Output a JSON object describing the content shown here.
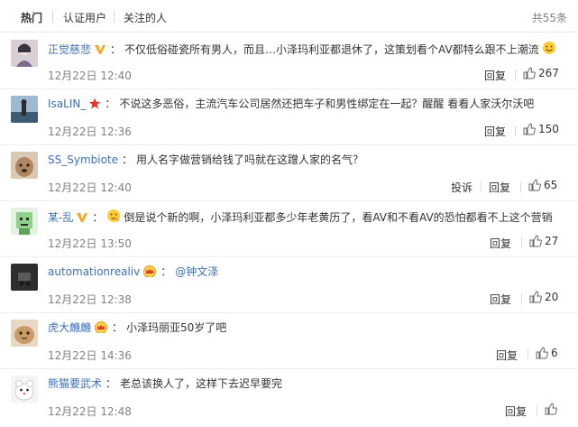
{
  "tabs": [
    {
      "label": "热门",
      "active": true
    },
    {
      "label": "认证用户",
      "active": false
    },
    {
      "label": "关注的人",
      "active": false
    }
  ],
  "total": "共55条",
  "comments": [
    {
      "user": "正觉慈悲",
      "badge": "v-gold-icon",
      "text": "不仅低俗碰瓷所有男人，而且…小泽玛利亚都退休了，这策划看个AV都特么跟不上潮流",
      "emoji": "smiley-icon",
      "time": "12月22日 12:40",
      "actions": [
        "回复"
      ],
      "likes": "267",
      "avatar_color": "#c9b9c4"
    },
    {
      "user": "IsaLIN_",
      "badge": "red-star-icon",
      "text": "不说这多恶俗，主流汽车公司居然还把车子和男性绑定在一起？醒醒 看看人家沃尔沃吧",
      "emoji": "",
      "time": "12月22日 12:36",
      "actions": [
        "回复"
      ],
      "likes": "150",
      "avatar_color": "#6d8fae"
    },
    {
      "user": "SS_Symbiote",
      "badge": "",
      "text": "用人名字做营销给钱了吗就在这蹭人家的名气？",
      "emoji": "",
      "time": "12月22日 12:40",
      "actions": [
        "投诉",
        "回复"
      ],
      "likes": "65",
      "avatar_color": "#b3947a"
    },
    {
      "user": "某-乱",
      "badge": "v-gold-icon",
      "prefix_emoji": "thinking-icon",
      "text": "倒是说个新的啊，小泽玛利亚都多少年老黄历了，看AV和不看AV的恐怕都看不上这个营销",
      "emoji": "",
      "time": "12月22日 13:50",
      "actions": [
        "回复"
      ],
      "likes": "27",
      "avatar_color": "#9bcf8f"
    },
    {
      "user": "automationrealiv",
      "badge": "crown-icon",
      "text": "@钟文泽",
      "is_mention": true,
      "emoji": "",
      "time": "12月22日 12:38",
      "actions": [
        "回复"
      ],
      "likes": "20",
      "avatar_color": "#3a3a3a"
    },
    {
      "user": "虎大虪虪",
      "badge": "crown-icon",
      "text": "小泽玛丽亚50岁了吧",
      "emoji": "",
      "time": "12月22日 14:36",
      "actions": [
        "回复"
      ],
      "likes": "6",
      "avatar_color": "#c49b6e"
    },
    {
      "user": "熊猫要武术",
      "badge": "",
      "text": "老总该换人了，这样下去迟早要完",
      "emoji": "",
      "time": "12月22日 12:48",
      "actions": [
        "回复"
      ],
      "likes": "",
      "avatar_color": "#e8e8e8"
    }
  ]
}
